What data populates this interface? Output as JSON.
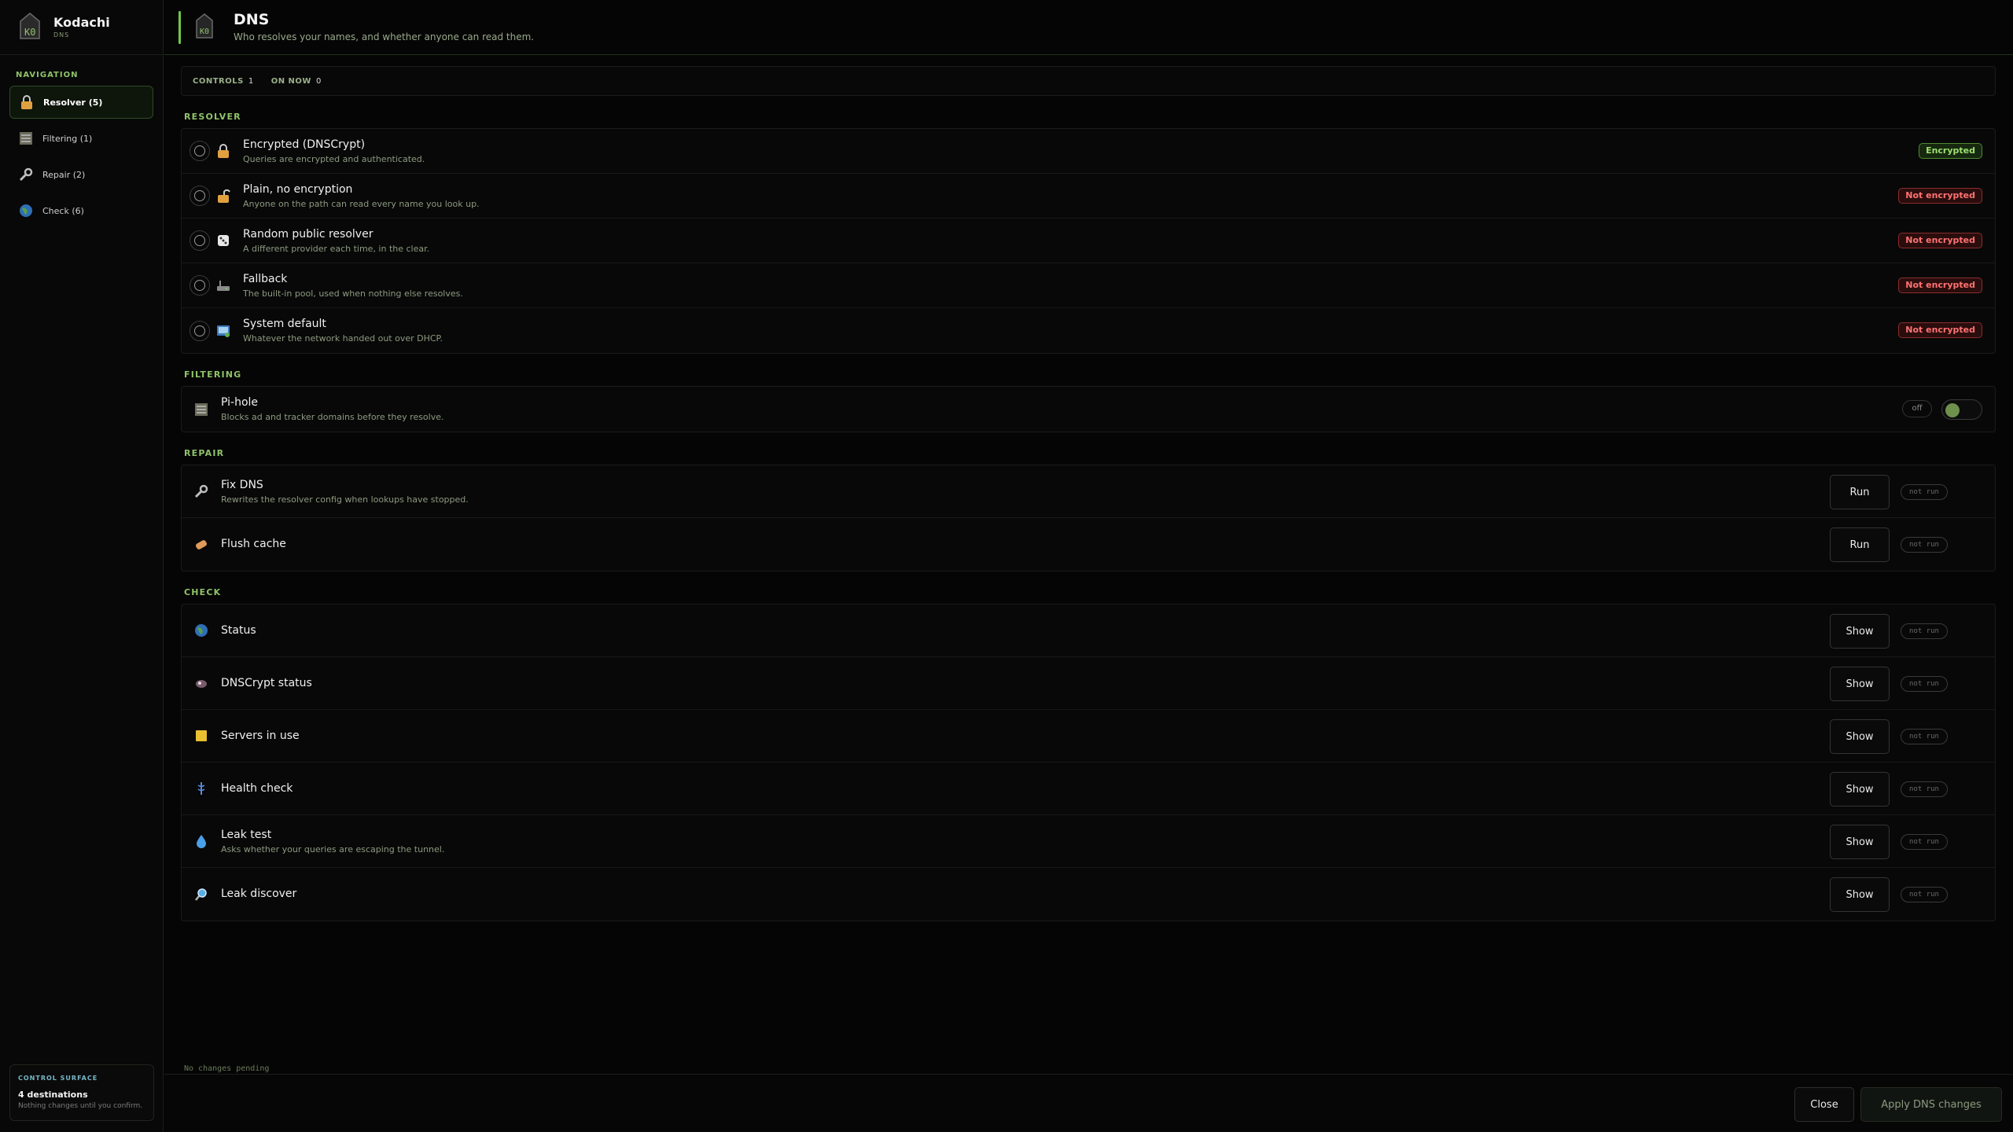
{
  "brand": {
    "name": "Kodachi",
    "sub": "DNS"
  },
  "nav": {
    "title": "NAVIGATION",
    "items": [
      {
        "label": "Resolver (5)",
        "icon": "lock-icon"
      },
      {
        "label": "Filtering (1)",
        "icon": "filter-icon"
      },
      {
        "label": "Repair (2)",
        "icon": "wrench-icon"
      },
      {
        "label": "Check (6)",
        "icon": "globe-icon"
      }
    ]
  },
  "control_surface": {
    "title": "CONTROL SURFACE",
    "main": "4 destinations",
    "sub": "Nothing changes until you confirm."
  },
  "header": {
    "title": "DNS",
    "subtitle": "Who resolves your names, and whether anyone can read them."
  },
  "stats": {
    "controls_label": "CONTROLS",
    "controls_value": "1",
    "on_now_label": "ON NOW",
    "on_now_value": "0"
  },
  "sections": {
    "resolver": "RESOLVER",
    "filtering": "FILTERING",
    "repair": "REPAIR",
    "check": "CHECK"
  },
  "resolver": [
    {
      "label": "Encrypted (DNSCrypt)",
      "desc": "Queries are encrypted and authenticated.",
      "badge": "Encrypted",
      "icon": "lock-closed-icon"
    },
    {
      "label": "Plain, no encryption",
      "desc": "Anyone on the path can read every name you look up.",
      "badge": "Not encrypted",
      "icon": "lock-open-icon"
    },
    {
      "label": "Random public resolver",
      "desc": "A different provider each time, in the clear.",
      "badge": "Not encrypted",
      "icon": "dice-icon"
    },
    {
      "label": "Fallback",
      "desc": "The built-in pool, used when nothing else resolves.",
      "badge": "Not encrypted",
      "icon": "router-icon"
    },
    {
      "label": "System default",
      "desc": "Whatever the network handed out over DHCP.",
      "badge": "Not encrypted",
      "icon": "system-icon"
    }
  ],
  "filtering": {
    "label": "Pi-hole",
    "desc": "Blocks ad and tracker domains before they resolve.",
    "state": "off"
  },
  "repair": [
    {
      "label": "Fix DNS",
      "desc": "Rewrites the resolver config when lookups have stopped.",
      "button": "Run",
      "status": "not run"
    },
    {
      "label": "Flush cache",
      "desc": "",
      "button": "Run",
      "status": "not run"
    }
  ],
  "check": [
    {
      "label": "Status",
      "desc": "",
      "button": "Show",
      "status": "not run"
    },
    {
      "label": "DNSCrypt status",
      "desc": "",
      "button": "Show",
      "status": "not run"
    },
    {
      "label": "Servers in use",
      "desc": "",
      "button": "Show",
      "status": "not run"
    },
    {
      "label": "Health check",
      "desc": "",
      "button": "Show",
      "status": "not run"
    },
    {
      "label": "Leak test",
      "desc": "Asks whether your queries are escaping the tunnel.",
      "button": "Show",
      "status": "not run"
    },
    {
      "label": "Leak discover",
      "desc": "",
      "button": "Show",
      "status": "not run"
    }
  ],
  "footer": {
    "pending": "No changes pending",
    "close": "Close",
    "apply": "Apply DNS changes"
  },
  "colors": {
    "accent": "#8fc36a",
    "good": "#9ee070",
    "bad": "#ff7272",
    "background": "#050505"
  }
}
